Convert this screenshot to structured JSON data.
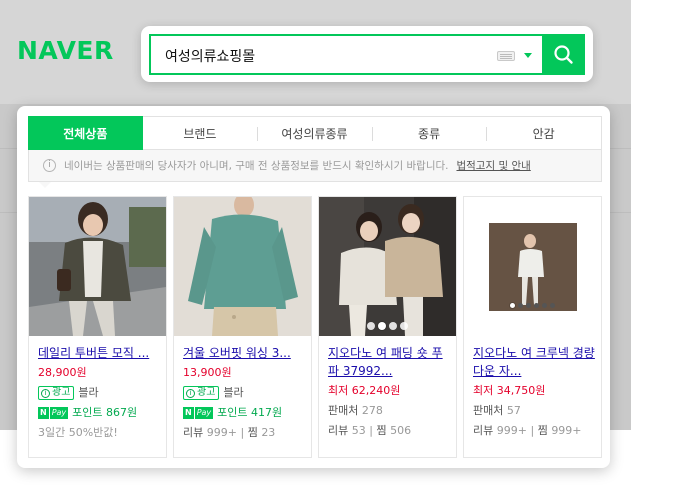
{
  "header": {
    "logo": "NAVER"
  },
  "search": {
    "query": "여성의류쇼핑몰"
  },
  "tabs": [
    {
      "label": "전체상품",
      "active": true
    },
    {
      "label": "브랜드"
    },
    {
      "label": "여성의류종류"
    },
    {
      "label": "종류"
    },
    {
      "label": "안감"
    }
  ],
  "notice": {
    "text": "네이버는 상품판매의 당사자가 아니며, 구매 전 상품정보를 반드시 확인하시기 바랍니다.",
    "link": "법적고지 및 안내"
  },
  "products": [
    {
      "title": "데일리 투버튼 모직 ...",
      "price": "28,900원",
      "ad_label": "광고",
      "seller": "블라",
      "npay_n": "N",
      "npay_p": "Pay",
      "points": "포인트 867원",
      "promo": "3일간 50%반값!"
    },
    {
      "title": "겨울 오버핏 워싱 3...",
      "price": "13,900원",
      "ad_label": "광고",
      "seller": "블라",
      "npay_n": "N",
      "npay_p": "Pay",
      "points": "포인트 417원",
      "review_label": "리뷰",
      "review_count": "999+",
      "sep": "|",
      "zzim_label": "찜",
      "zzim_count": "23"
    },
    {
      "title": "지오다노 여 패딩 숏 푸파 37992...",
      "price": "최저 62,240원",
      "seller_label": "판매처",
      "seller_count": "278",
      "review_label": "리뷰",
      "review_count": "53",
      "sep": "|",
      "zzim_label": "찜",
      "zzim_count": "506"
    },
    {
      "title": "지오다노 여 크루넥 경량다운 자...",
      "price": "최저 34,750원",
      "seller_label": "판매처",
      "seller_count": "57",
      "review_label": "리뷰",
      "review_count": "999+",
      "sep": "|",
      "zzim_label": "찜",
      "zzim_count": "999+"
    }
  ],
  "colors": {
    "brand": "#03c75a",
    "price": "#e4002b",
    "link": "#1a0dab"
  },
  "icons": [
    "search-icon",
    "keyboard-icon",
    "caret-down-icon",
    "info-icon",
    "ad-info-icon",
    "npay-icon"
  ]
}
